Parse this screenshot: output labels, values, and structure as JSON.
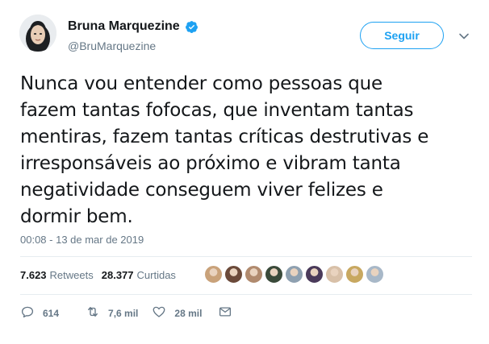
{
  "author": {
    "name": "Bruna Marquezine",
    "handle": "@BruMarquezine",
    "verified": true
  },
  "follow_label": "Seguir",
  "tweet": {
    "text": "Nunca vou entender como pessoas que\nfazem tantas fofocas, que inventam tantas\nmentiras, fazem tantas críticas destrutivas e\nirresponsáveis ao próximo e vibram tanta\nnegatividade conseguem viver felizes e\ndormir bem.",
    "timestamp": "00:08 - 13 de mar de 2019"
  },
  "stats": {
    "retweets_count": "7.623",
    "retweets_label": "Retweets",
    "likes_count": "28.377",
    "likes_label": "Curtidas"
  },
  "actions": {
    "replies": "614",
    "retweets": "7,6 mil",
    "likes": "28 mil"
  },
  "colors": {
    "accent": "#1da1f2",
    "text": "#14171a",
    "muted": "#657786",
    "divider": "#e6ecf0"
  },
  "liker_avatars": [
    {
      "color": "#c9a27a"
    },
    {
      "color": "#6b4a3a"
    },
    {
      "color": "#b08a6e"
    },
    {
      "color": "#3a4a3a"
    },
    {
      "color": "#8ea0b0"
    },
    {
      "color": "#4a3a5a"
    },
    {
      "color": "#d8c0a8"
    },
    {
      "color": "#c8a860"
    },
    {
      "color": "#a8b8c8"
    }
  ]
}
